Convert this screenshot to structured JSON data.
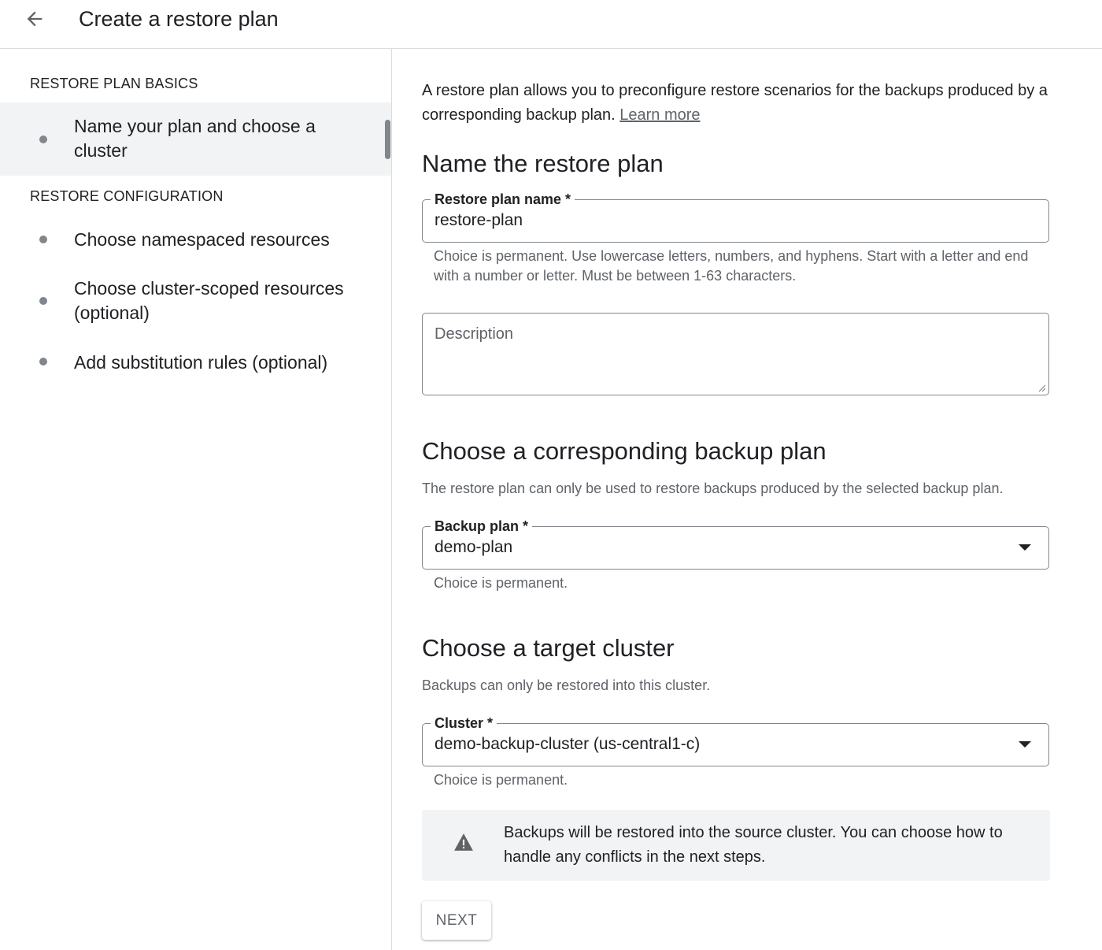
{
  "header": {
    "title": "Create a restore plan"
  },
  "sidebar": {
    "sections": [
      {
        "heading": "RESTORE PLAN BASICS",
        "steps": [
          {
            "label": "Name your plan and choose a cluster",
            "active": true
          }
        ]
      },
      {
        "heading": "RESTORE CONFIGURATION",
        "steps": [
          {
            "label": "Choose namespaced resources"
          },
          {
            "label": "Choose cluster-scoped resources (optional)"
          },
          {
            "label": "Add substitution rules (optional)"
          }
        ]
      }
    ]
  },
  "main": {
    "intro_text": "A restore plan allows you to preconfigure restore scenarios for the backups produced by a corresponding backup plan. ",
    "learn_more": "Learn more",
    "name_section": {
      "heading": "Name the restore plan",
      "name_label": "Restore plan name *",
      "name_value": "restore-plan",
      "name_hint": "Choice is permanent. Use lowercase letters, numbers, and hyphens. Start with a letter and end with a number or letter. Must be between 1-63 characters.",
      "description_placeholder": "Description"
    },
    "backup_section": {
      "heading": "Choose a corresponding backup plan",
      "description": "The restore plan can only be used to restore backups produced by the selected backup plan.",
      "label": "Backup plan *",
      "value": "demo-plan",
      "hint": "Choice is permanent."
    },
    "cluster_section": {
      "heading": "Choose a target cluster",
      "description": "Backups can only be restored into this cluster.",
      "label": "Cluster *",
      "value": "demo-backup-cluster (us-central1-c)",
      "hint": "Choice is permanent."
    },
    "warning_text": "Backups will be restored into the source cluster. You can choose how to handle any conflicts in the next steps.",
    "next_label": "NEXT"
  },
  "icons": {
    "back": "arrow-back-icon",
    "warning": "warning-icon",
    "dropdown": "caret-down-icon"
  }
}
